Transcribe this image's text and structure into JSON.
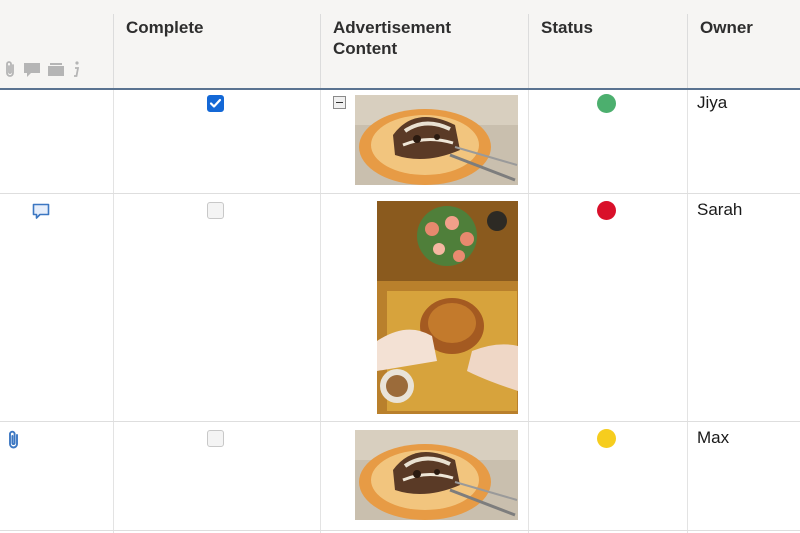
{
  "columns": {
    "complete": "Complete",
    "ad_content": "Advertisement\nContent",
    "status": "Status",
    "owner": "Owner"
  },
  "header_icons": [
    "paperclip-icon",
    "comment-icon",
    "proofing-icon",
    "info-icon"
  ],
  "rows": [
    {
      "complete": true,
      "status_color": "#4caf6e",
      "owner": "Jiya",
      "indicator": "",
      "image": "cake-plate-image"
    },
    {
      "complete": false,
      "status_color": "#d9102a",
      "owner": "Sarah",
      "indicator": "comment-icon",
      "image": "flowers-table-image"
    },
    {
      "complete": false,
      "status_color": "#f6cd1e",
      "owner": "Max",
      "indicator": "paperclip-icon",
      "image": "cake-plate-image"
    }
  ],
  "colors": {
    "accent": "#1468d6",
    "header_bg": "#f6f5f3",
    "header_rule": "#5a7390",
    "icon_blue": "#3c77c2"
  }
}
